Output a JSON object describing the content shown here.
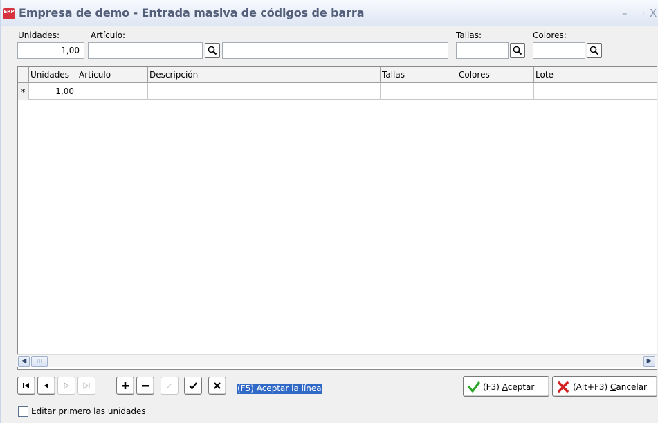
{
  "window": {
    "title": "Empresa de demo - Entrada masiva de códigos de barra",
    "icon_text": "ERP",
    "minimize": "–",
    "maximize": "▭",
    "close": "X"
  },
  "form": {
    "unidades_label": "Unidades:",
    "unidades_value": "1,00",
    "articulo_label": "Artículo:",
    "articulo_value": "",
    "descripcion_value": "",
    "tallas_label": "Tallas:",
    "tallas_value": "",
    "colores_label": "Colores:",
    "colores_value": ""
  },
  "grid": {
    "columns": [
      "Unidades",
      "Artículo",
      "Descripción",
      "Tallas",
      "Colores",
      "Lote"
    ],
    "rows": [
      {
        "indicator": "*",
        "cells": [
          "1,00",
          "",
          "",
          "",
          "",
          ""
        ]
      }
    ]
  },
  "navigator": {
    "buttons": [
      "first",
      "prior",
      "next",
      "last",
      "insert",
      "delete",
      "edit",
      "post",
      "cancel"
    ],
    "hint": "(F5) Aceptar la línea"
  },
  "actions": {
    "accept_prefix": "(F3) ",
    "accept_key": "A",
    "accept_rest": "ceptar",
    "cancel_prefix": "(Alt+F3) ",
    "cancel_key": "C",
    "cancel_rest": "ancelar"
  },
  "options": {
    "edit_units_first_label": "Editar primero las unidades",
    "edit_units_first_checked": false
  },
  "colors": {
    "title_text": "#54607a",
    "hint_bg": "#3169c6",
    "accept_green": "#2aa52a",
    "cancel_red": "#d42020"
  }
}
